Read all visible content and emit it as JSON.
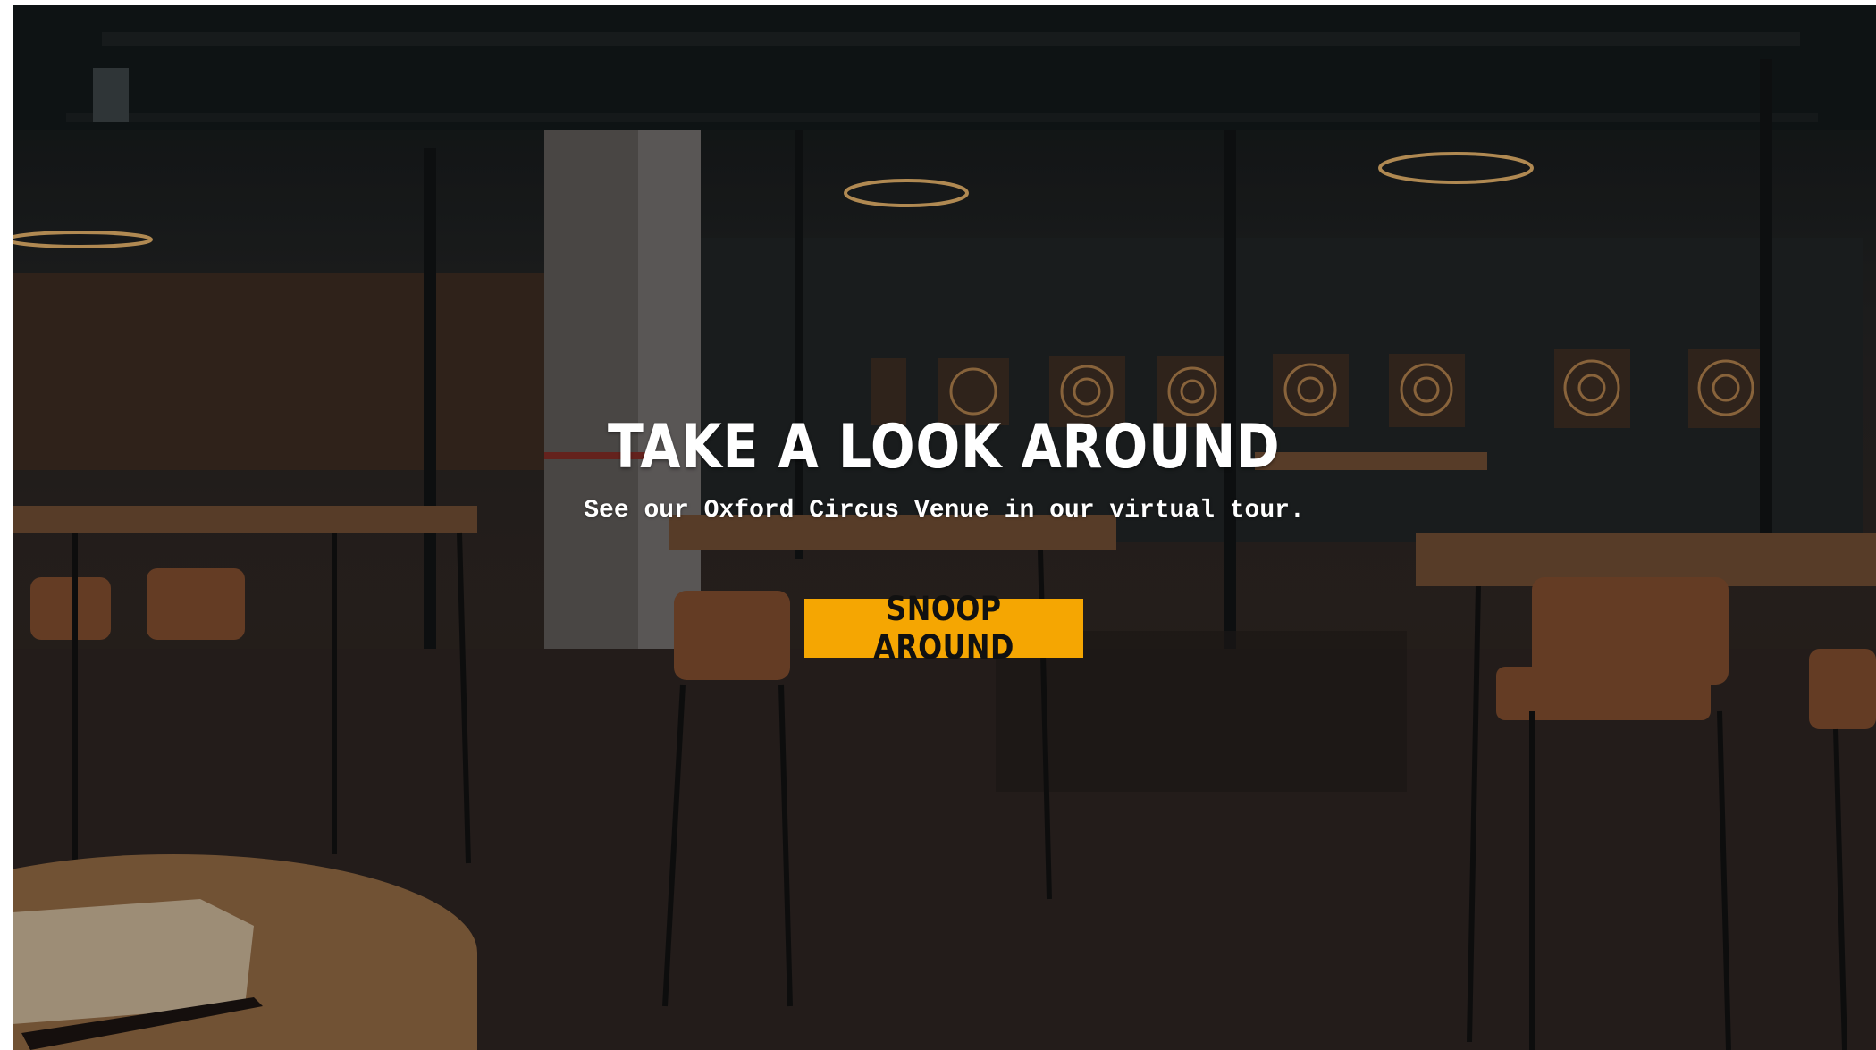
{
  "hero": {
    "title": "TAKE A LOOK AROUND",
    "subtitle": "See our Oxford Circus Venue in our virtual tour.",
    "cta_label": "SNOOP AROUND",
    "accent_color": "#f5a602"
  }
}
